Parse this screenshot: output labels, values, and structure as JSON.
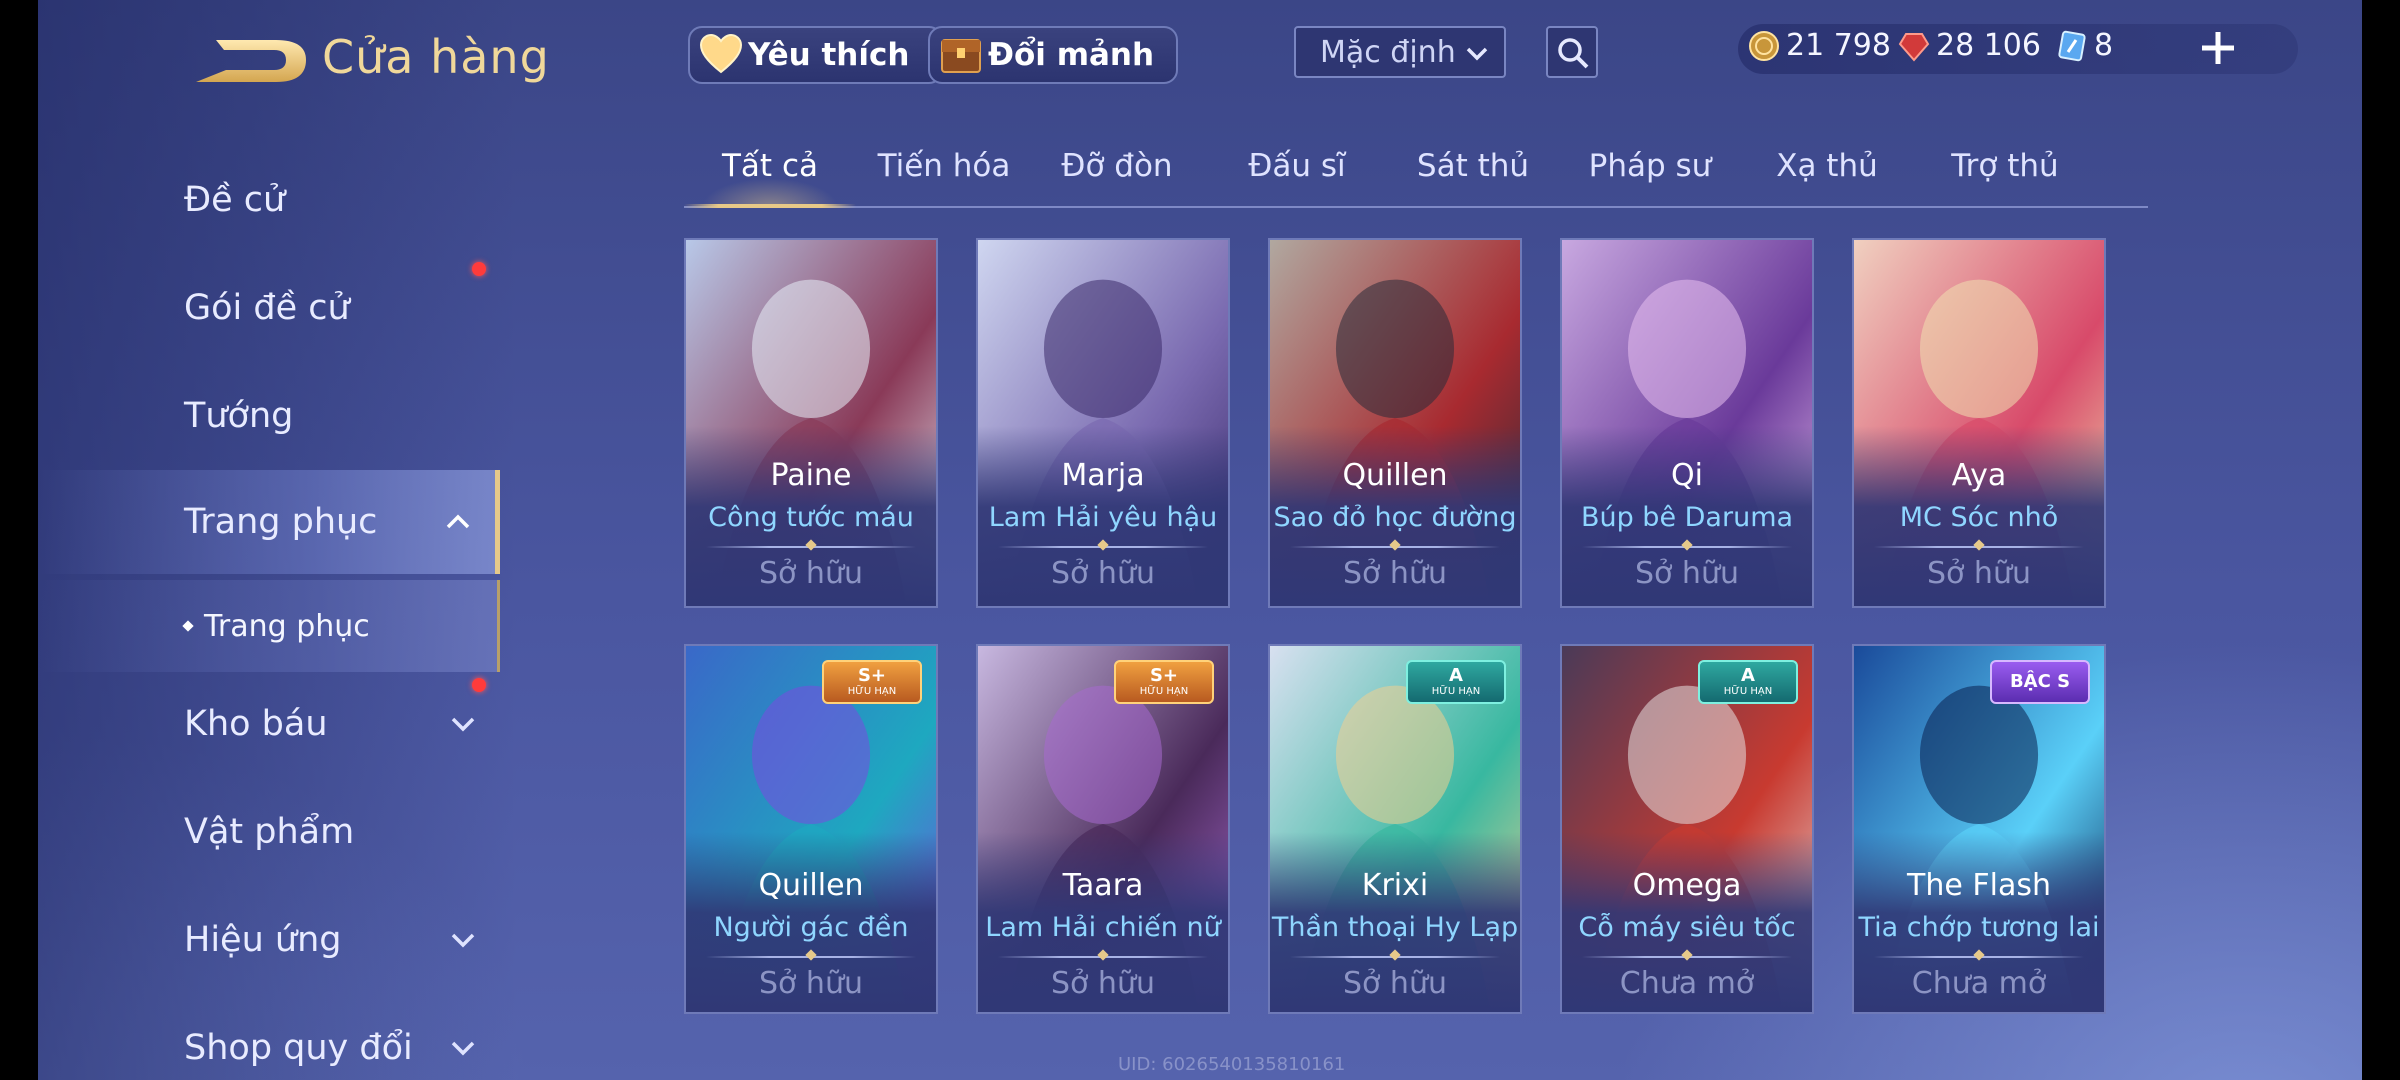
{
  "header": {
    "title": "Cửa hàng",
    "favorites_label": "Yêu thích",
    "fragments_label": "Đổi mảnh",
    "sort_value": "Mặc định"
  },
  "currency": {
    "gold": "21 798",
    "ruby": "28 106",
    "voucher": "8"
  },
  "sidebar": {
    "items": [
      {
        "label": "Đề cử"
      },
      {
        "label": "Gói đề cử"
      },
      {
        "label": "Tướng"
      },
      {
        "label": "Trang phục"
      },
      {
        "label": "Kho báu"
      },
      {
        "label": "Vật phẩm"
      },
      {
        "label": "Hiệu ứng"
      },
      {
        "label": "Shop quy đổi"
      }
    ],
    "sub_item": "Trang phục"
  },
  "tabs": [
    "Tất cả",
    "Tiến hóa",
    "Đỡ đòn",
    "Đấu sĩ",
    "Sát thủ",
    "Pháp sư",
    "Xạ thủ",
    "Trợ thủ"
  ],
  "cards": [
    {
      "hero": "Paine",
      "skin": "Công tước máu",
      "status": "Sở hữu",
      "badge": null
    },
    {
      "hero": "Marja",
      "skin": "Lam Hải yêu hậu",
      "status": "Sở hữu",
      "badge": null
    },
    {
      "hero": "Quillen",
      "skin": "Sao đỏ học đường",
      "status": "Sở hữu",
      "badge": null
    },
    {
      "hero": "Qi",
      "skin": "Búp bê Daruma",
      "status": "Sở hữu",
      "badge": null
    },
    {
      "hero": "Aya",
      "skin": "MC Sóc nhỏ",
      "status": "Sở hữu",
      "badge": null
    },
    {
      "hero": "Quillen",
      "skin": "Người gác đền",
      "status": "Sở hữu",
      "badge": {
        "grade": "S+",
        "limited": "HỮU HẠN"
      }
    },
    {
      "hero": "Taara",
      "skin": "Lam Hải chiến nữ",
      "status": "Sở hữu",
      "badge": {
        "grade": "S+",
        "limited": "HỮU HẠN"
      }
    },
    {
      "hero": "Krixi",
      "skin": "Thần thoại Hy Lạp",
      "status": "Sở hữu",
      "badge": {
        "grade": "A",
        "limited": "HỮU HẠN"
      }
    },
    {
      "hero": "Omega",
      "skin": "Cỗ máy siêu tốc",
      "status": "Chưa mở",
      "badge": {
        "grade": "A",
        "limited": "HỮU HẠN"
      }
    },
    {
      "hero": "The Flash",
      "skin": "Tia chớp tương lai",
      "status": "Chưa mở",
      "badge": {
        "grade": "BẬC S",
        "limited": ""
      }
    }
  ],
  "uid": "UID: 6026540135810161",
  "colors": {
    "accent_gold": "#e6c98a",
    "skin_name_blue": "#8fd6ff",
    "status_grey": "#8c94c4",
    "notification_red": "#ff3b3b"
  }
}
